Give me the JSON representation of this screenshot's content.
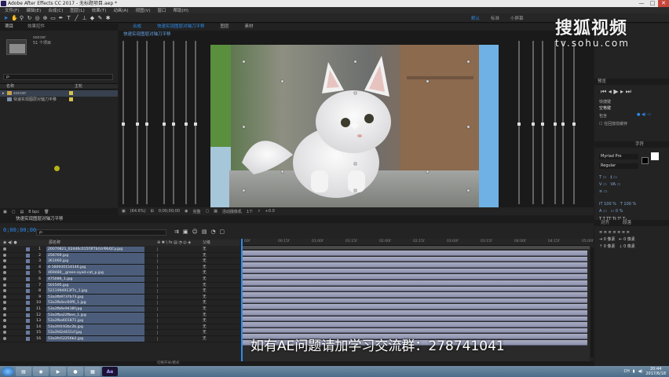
{
  "window": {
    "title": "Adobe After Effects CC 2017 - 无标题项目.aep *",
    "controls": [
      "—",
      "□",
      "✕"
    ]
  },
  "menu": [
    "文件(F)",
    "编辑(E)",
    "合成(C)",
    "图层(L)",
    "效果(T)",
    "动画(A)",
    "视图(V)",
    "窗口",
    "帮助(H)"
  ],
  "workspaces": [
    "默认",
    "标准",
    "小屏幕"
  ],
  "project": {
    "tabs": [
      "项目",
      "效果控件"
    ],
    "selected_name": "soccer",
    "selected_info": "51 个项目",
    "search_placeholder": "ρ-",
    "col_name": "名称",
    "col_label": "主轮",
    "items": [
      {
        "name": "soccer",
        "color": "#d9c24b"
      },
      {
        "name": "快速实现图层对轴刀平移",
        "color": "#d9c24b"
      }
    ],
    "bpc": "8 bpc"
  },
  "comp": {
    "tabs": [
      "合成",
      "快速实现图层对轴刀平移",
      "图层",
      "素材"
    ],
    "breadcrumb": "快速实现图层对轴刀平移",
    "footer": {
      "zoom": "(64.6%)",
      "time": "0;00;00;00",
      "res": "完整",
      "camera": "活动摄像机",
      "views": "1个",
      "offset": "+0.0"
    }
  },
  "right_panel": {
    "preview_hdr": "预览",
    "shortcut_label": "快捷键",
    "shortcut_value": "空格键",
    "include_label": "包含",
    "cache_label": "在回放前缓存",
    "character_hdr": "字符",
    "font": "Myriad Pro",
    "style": "Regular",
    "align_hdr": "对齐",
    "paragraph_hdr": "段落"
  },
  "timeline": {
    "tab": "快速实现图层对轴刀平移",
    "time": "0;00;00;00",
    "search_placeholder": "ρ-",
    "col_source": "源名称",
    "col_parent": "父级",
    "ruler_ticks": [
      "00f",
      "00:15f",
      "01:00f",
      "01:15f",
      "02:00f",
      "02:15f",
      "03:00f",
      "03:15f",
      "04:00f",
      "04:15f",
      "05:00f"
    ],
    "parent_value": "无",
    "layers": [
      {
        "num": "1",
        "name": "20070821_024d6c015f3f7b(Url9bQCy.jpg"
      },
      {
        "num": "2",
        "name": "256769.jpg"
      },
      {
        "num": "3",
        "name": "361060.jpg"
      },
      {
        "num": "4",
        "name": "4-160930154146.jpg"
      },
      {
        "num": "5",
        "name": "469480__green-eyed-cat_p.jpg"
      },
      {
        "num": "6",
        "name": "475086_1.jpg"
      },
      {
        "num": "7",
        "name": "501595.jpg"
      },
      {
        "num": "8",
        "name": "5211994913f7c_1.jpg"
      },
      {
        "num": "9",
        "name": "53a3fb9737b73.jpg"
      },
      {
        "num": "10",
        "name": "53a3fb4ec60f6_1.jpg"
      },
      {
        "num": "11",
        "name": "53a3fb6e9438f.jpg"
      },
      {
        "num": "12",
        "name": "53a3fba22fbee_1.jpg"
      },
      {
        "num": "13",
        "name": "53a3fba601871.jpg"
      },
      {
        "num": "14",
        "name": "53a3fd192bc2b.jpg"
      },
      {
        "num": "15",
        "name": "53a3fd2d431cf.jpg"
      },
      {
        "num": "16",
        "name": "53a3fe52256b2.jpg"
      }
    ],
    "bottom_label": "切换开关/模式"
  },
  "watermark": {
    "main": "搜狐视频",
    "url": "tv.sohu.com"
  },
  "overlay_text": "如有AE问题请加学习交流群：278741041",
  "taskbar": {
    "apps": [
      "",
      "",
      "",
      "",
      "",
      "",
      "Ae"
    ],
    "tray_lang": "CH",
    "time": "20:44",
    "date": "2017/6/18"
  }
}
